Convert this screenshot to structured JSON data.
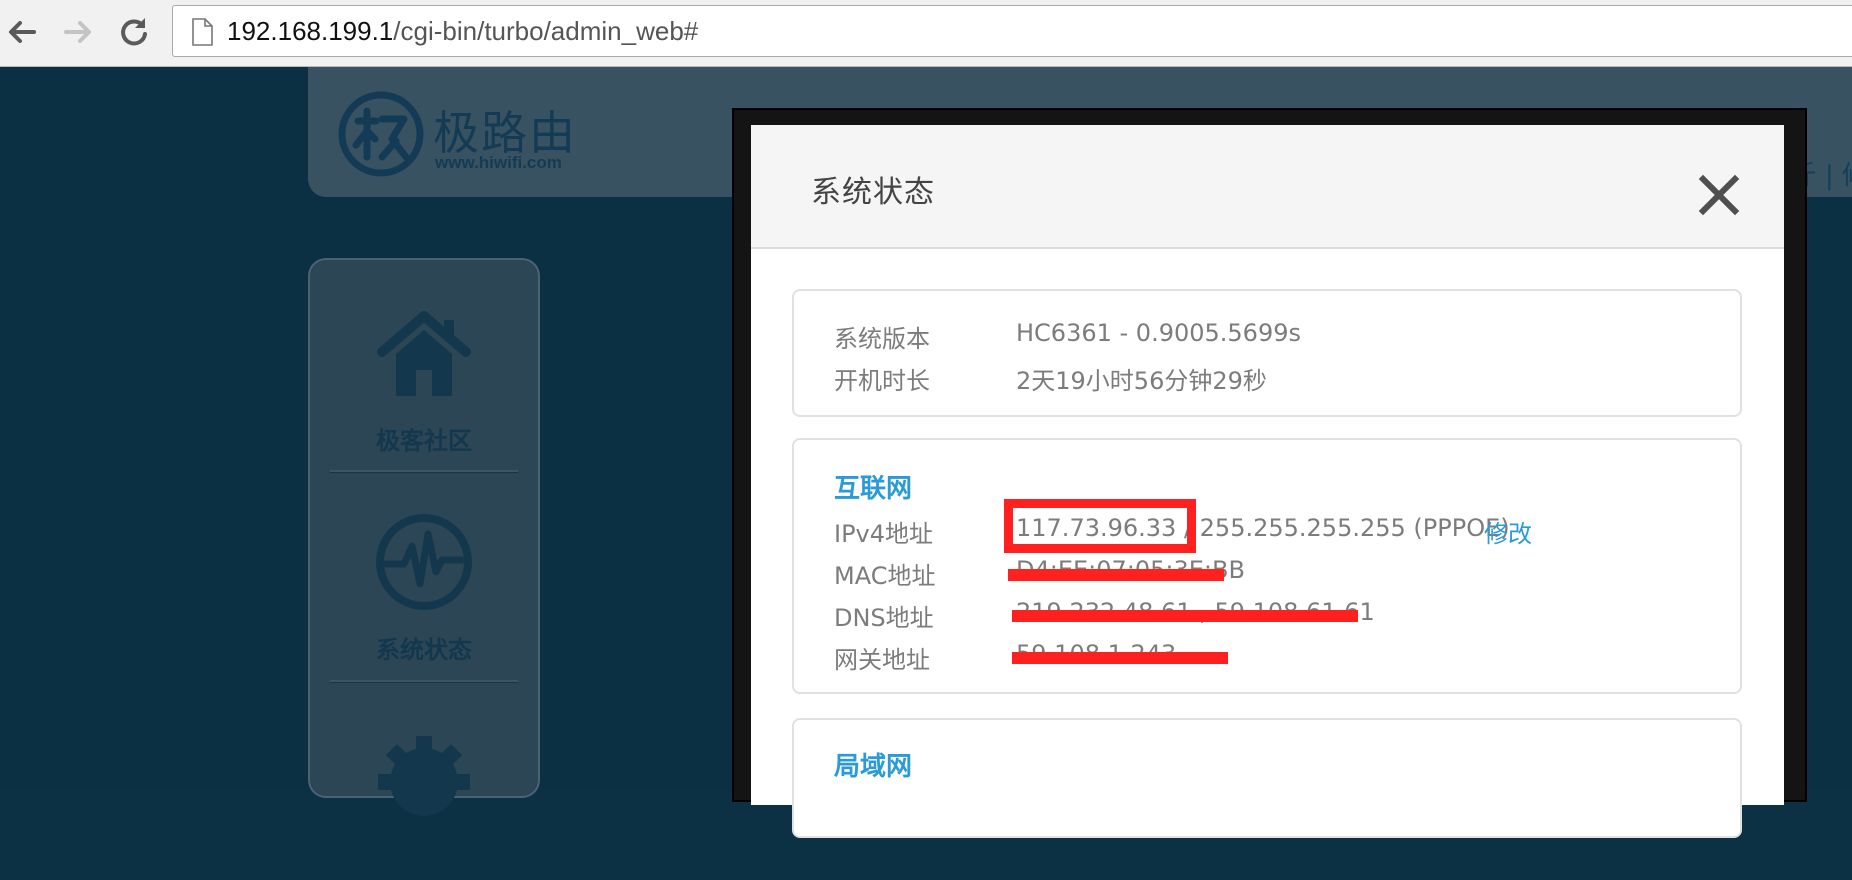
{
  "browser": {
    "url_host": "192.168.199.1",
    "url_path": "/cgi-bin/turbo/admin_web#"
  },
  "brand": {
    "title": "极路由",
    "url": "www.hiwifi.com",
    "header_right_text": "斤 |  修"
  },
  "sidebar": {
    "items": [
      {
        "label": "极客社区",
        "icon": "home-icon"
      },
      {
        "label": "系统状态",
        "icon": "pulse-icon"
      },
      {
        "label": "",
        "icon": "gear-icon"
      }
    ]
  },
  "modal": {
    "title": "系统状态",
    "system": {
      "rows": [
        {
          "key": "系统版本",
          "value": "HC6361 - 0.9005.5699s"
        },
        {
          "key": "开机时长",
          "value": "2天19小时56分钟29秒"
        }
      ]
    },
    "internet": {
      "title": "互联网",
      "rows": [
        {
          "key": "IPv4地址",
          "value": "117.73.96.33 / 255.255.255.255 (PPPOE)"
        },
        {
          "key": "MAC地址",
          "value": "D4:EE:07:05:3E:BB"
        },
        {
          "key": "DNS地址",
          "value": "219.232.48.61 , 59.108.61.61"
        },
        {
          "key": "网关地址",
          "value": "59.108.1.243"
        }
      ],
      "edit_label": "修改"
    },
    "lan": {
      "title": "局域网"
    }
  },
  "colors": {
    "accent": "#2a9bd8",
    "redaction": "#ff2020",
    "page_bg": "#0b2f43"
  }
}
